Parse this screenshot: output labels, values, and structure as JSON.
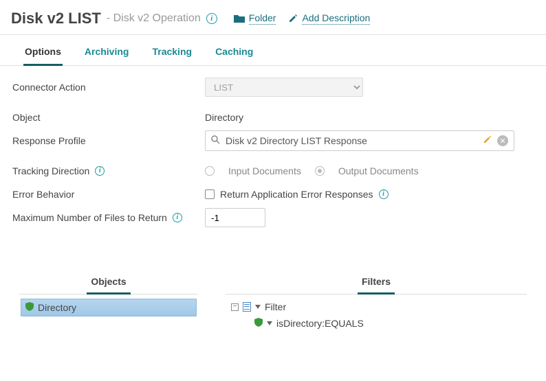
{
  "header": {
    "title": "Disk v2 LIST",
    "subtitle": "- Disk v2 Operation",
    "folder_link": "Folder",
    "add_desc_link": "Add Description"
  },
  "tabs": [
    "Options",
    "Archiving",
    "Tracking",
    "Caching"
  ],
  "active_tab": 0,
  "form": {
    "connector_action_label": "Connector Action",
    "connector_action_value": "LIST",
    "object_label": "Object",
    "object_value": "Directory",
    "response_profile_label": "Response Profile",
    "response_profile_value": "Disk v2 Directory LIST Response",
    "tracking_direction_label": "Tracking Direction",
    "tracking_input": "Input Documents",
    "tracking_output": "Output Documents",
    "tracking_selected": "output",
    "error_behavior_label": "Error Behavior",
    "error_checkbox_label": "Return Application Error Responses",
    "error_checked": false,
    "max_files_label": "Maximum Number of Files to Return",
    "max_files_value": "-1"
  },
  "lower": {
    "objects_tab": "Objects",
    "filters_tab": "Filters",
    "objects": {
      "item": "Directory"
    },
    "filters": {
      "root": "Filter",
      "child": "isDirectory:EQUALS"
    }
  }
}
